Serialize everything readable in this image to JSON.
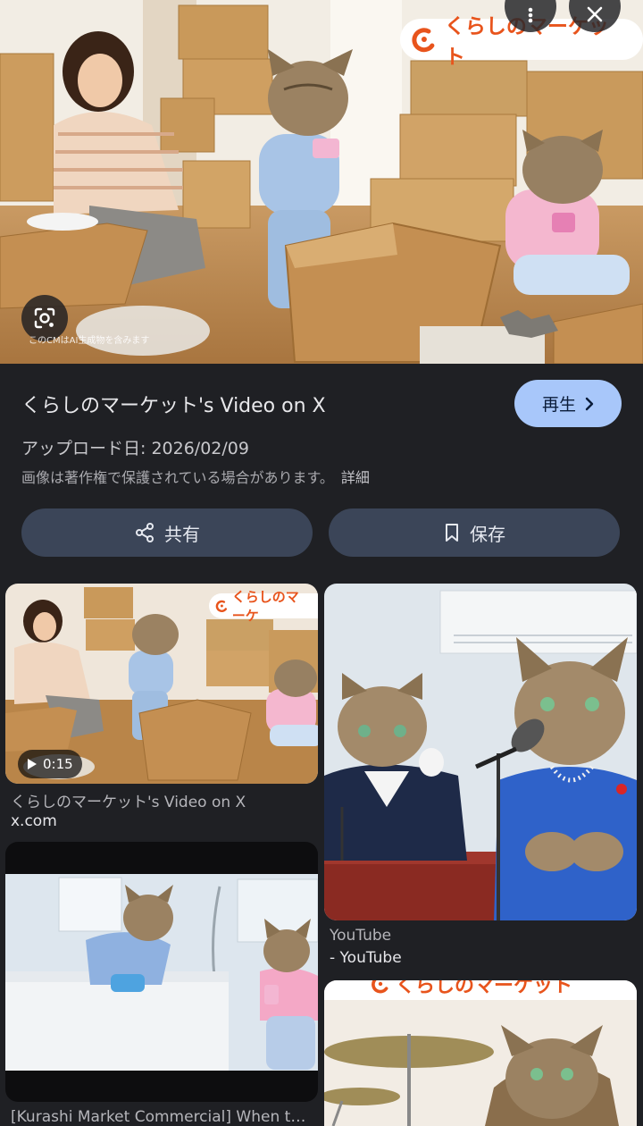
{
  "hero": {
    "brand_text": "くらしのマーケット",
    "ai_note": "このCMはAI生成物を含みます"
  },
  "info": {
    "title": "くらしのマーケット's Video on X",
    "play_label": "再生",
    "upload_label": "アップロード日: 2026/02/09",
    "copyright_text": "画像は著作権で保護されている場合があります。",
    "details_label": "詳細"
  },
  "actions": {
    "share_label": "共有",
    "save_label": "保存"
  },
  "results": [
    {
      "duration": "0:15",
      "title": "くらしのマーケット's Video on X",
      "site": "x.com",
      "brand_text": "くらしのマーケ"
    },
    {
      "title": "YouTube",
      "site": "- YouTube"
    },
    {
      "title": "[Kurashi Market Commercial] When the..."
    },
    {
      "brand_text": "くらしのマーケット"
    }
  ],
  "colors": {
    "background": "#1f2024",
    "accent": "#a8c7fa",
    "button_bg": "#3b4558",
    "brand": "#e8541c"
  },
  "icons": [
    "more-vert-icon",
    "close-icon",
    "lens-icon",
    "chevron-right-icon",
    "share-icon",
    "bookmark-icon",
    "play-icon"
  ]
}
